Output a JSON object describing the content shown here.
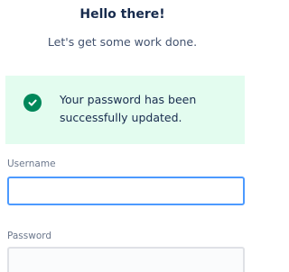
{
  "header": {
    "title": "Hello there!",
    "subtitle": "Let's get some work done."
  },
  "alert": {
    "icon": "check-circle-icon",
    "message": "Your password has been successfully updated.",
    "background_color": "#e3fcef",
    "icon_color": "#00875a"
  },
  "form": {
    "username": {
      "label": "Username",
      "value": "",
      "focus_color": "#4c9aff"
    },
    "password": {
      "label": "Password",
      "value": ""
    }
  }
}
